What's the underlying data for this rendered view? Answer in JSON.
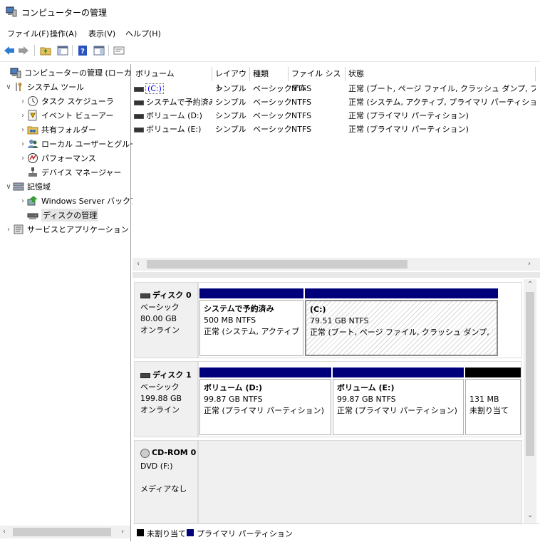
{
  "window": {
    "title": "コンピューターの管理"
  },
  "menu": [
    "ファイル(F)",
    "操作(A)",
    "表示(V)",
    "ヘルプ(H)"
  ],
  "toolbar": {
    "icons": [
      "back-icon",
      "forward-icon",
      "up-folder-icon",
      "show-hide-tree-icon",
      "help-icon",
      "console-icon",
      "properties-icon"
    ]
  },
  "tree": {
    "root": "コンピューターの管理 (ローカル)",
    "system_tools": "システム ツール",
    "task_scheduler": "タスク スケジューラ",
    "event_viewer": "イベント ビューアー",
    "shared_folders": "共有フォルダー",
    "local_users": "ローカル ユーザーとグループ",
    "performance": "パフォーマンス",
    "device_manager": "デバイス マネージャー",
    "storage": "記憶域",
    "windows_server_backup": "Windows Server バックア",
    "disk_management": "ディスクの管理",
    "services_apps": "サービスとアプリケーション"
  },
  "volumes": {
    "columns": [
      "ボリューム",
      "レイアウト",
      "種類",
      "ファイル システム",
      "状態"
    ],
    "rows": [
      {
        "name": "(C:)",
        "layout": "シンプル",
        "type": "ベーシック",
        "fs": "NTFS",
        "status": "正常 (ブート, ページ ファイル, クラッシュ ダンプ, プライマリ パー"
      },
      {
        "name": "システムで予約済み",
        "layout": "シンプル",
        "type": "ベーシック",
        "fs": "NTFS",
        "status": "正常 (システム, アクティブ, プライマリ パーティション)"
      },
      {
        "name": "ボリューム (D:)",
        "layout": "シンプル",
        "type": "ベーシック",
        "fs": "NTFS",
        "status": "正常 (プライマリ パーティション)"
      },
      {
        "name": "ボリューム (E:)",
        "layout": "シンプル",
        "type": "ベーシック",
        "fs": "NTFS",
        "status": "正常 (プライマリ パーティション)"
      }
    ]
  },
  "disks": {
    "disk0": {
      "name": "ディスク 0",
      "kind": "ベーシック",
      "size": "80.00 GB",
      "state": "オンライン",
      "p1": {
        "title": "システムで予約済み",
        "size": "500 MB NTFS",
        "status": "正常 (システム, アクティブ, プラ"
      },
      "p2": {
        "title": "(C:)",
        "size": "79.51 GB NTFS",
        "status": "正常 (ブート, ページ ファイル, クラッシュ ダンプ, プライマリ パー"
      }
    },
    "disk1": {
      "name": "ディスク 1",
      "kind": "ベーシック",
      "size": "199.88 GB",
      "state": "オンライン",
      "p1": {
        "title": "ボリューム (D:)",
        "size": "99.87 GB NTFS",
        "status": "正常 (プライマリ パーティション)"
      },
      "p2": {
        "title": "ボリューム (E:)",
        "size": "99.87 GB NTFS",
        "status": "正常 (プライマリ パーティション)"
      },
      "p3": {
        "size": "131 MB",
        "status": "未割り当て"
      }
    },
    "cdrom0": {
      "name": "CD-ROM 0",
      "drive": "DVD (F:)",
      "media": "メディアなし"
    }
  },
  "legend": {
    "unallocated": "未割り当て",
    "primary": "プライマリ パーティション"
  },
  "colors": {
    "primary_bar": "#00007b",
    "unallocated_bar": "#000000",
    "selection": "#cce8ff",
    "link_blue": "#0000ff"
  }
}
